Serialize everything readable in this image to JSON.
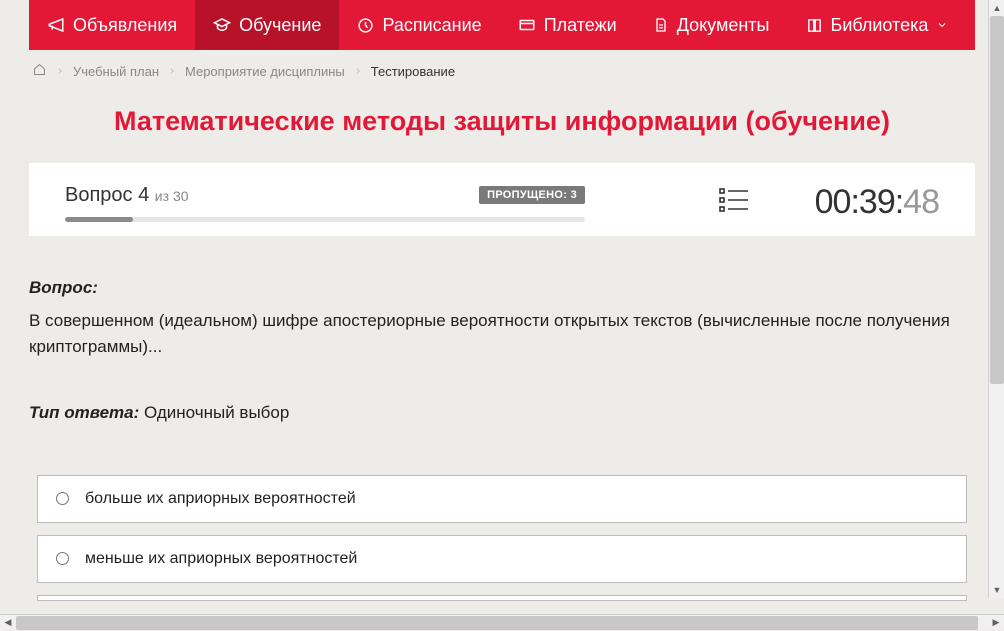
{
  "nav": {
    "items": [
      {
        "label": "Объявления",
        "icon": "megaphone"
      },
      {
        "label": "Обучение",
        "icon": "grad-cap",
        "active": true
      },
      {
        "label": "Расписание",
        "icon": "clock"
      },
      {
        "label": "Платежи",
        "icon": "card"
      },
      {
        "label": "Документы",
        "icon": "doc"
      },
      {
        "label": "Библиотека",
        "icon": "book",
        "dropdown": true
      }
    ]
  },
  "breadcrumb": {
    "items": [
      {
        "label": "Учебный план"
      },
      {
        "label": "Мероприятие дисциплины"
      }
    ],
    "current": "Тестирование"
  },
  "title": "Математические методы защиты информации (обучение)",
  "status": {
    "question_word": "Вопрос",
    "question_num": "4",
    "question_of": "из",
    "question_total": "30",
    "skipped_label": "ПРОПУЩЕНО: 3",
    "progress_pct": 13,
    "timer_main": "00:39:",
    "timer_sec": "48"
  },
  "question": {
    "label": "Вопрос:",
    "text": "В совершенном (идеальном) шифре апостериорные вероятности открытых текстов (вычисленные после получения криптограммы)...",
    "type_label": "Тип ответа:",
    "type_value": "Одиночный выбор"
  },
  "options": [
    {
      "text": "больше их априорных вероятностей"
    },
    {
      "text": "меньше их априорных вероятностей"
    }
  ]
}
